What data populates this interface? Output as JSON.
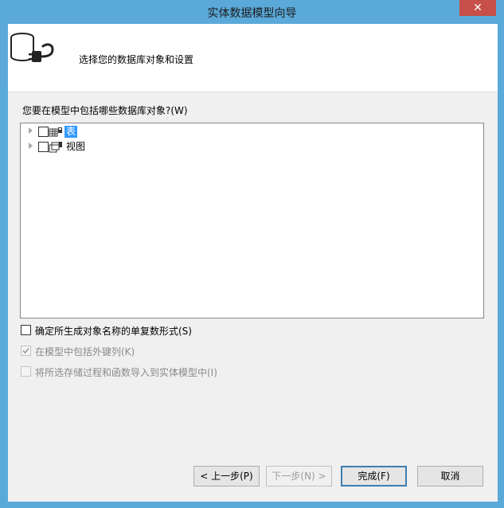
{
  "window": {
    "title": "实体数据模型向导",
    "close_glyph": "✕"
  },
  "header": {
    "title": "选择您的数据库对象和设置"
  },
  "question": "您要在模型中包括哪些数据库对象?(W)",
  "tree": {
    "items": [
      {
        "label": "表",
        "selected": true
      },
      {
        "label": "视图",
        "selected": false
      }
    ]
  },
  "options": {
    "pluralize": {
      "label": "确定所生成对象名称的单复数形式(S)",
      "checked": false,
      "enabled": true
    },
    "foreign_keys": {
      "label": "在模型中包括外键列(K)",
      "checked": true,
      "enabled": false
    },
    "import_procs": {
      "label": "将所选存储过程和函数导入到实体模型中(I)",
      "checked": false,
      "enabled": false
    }
  },
  "buttons": {
    "previous": "< 上一步(P)",
    "next": "下一步(N) >",
    "finish": "完成(F)",
    "cancel": "取消"
  },
  "colors": {
    "titlebar": "#5aa9d9",
    "selection": "#3399ff",
    "close": "#c7504a"
  }
}
